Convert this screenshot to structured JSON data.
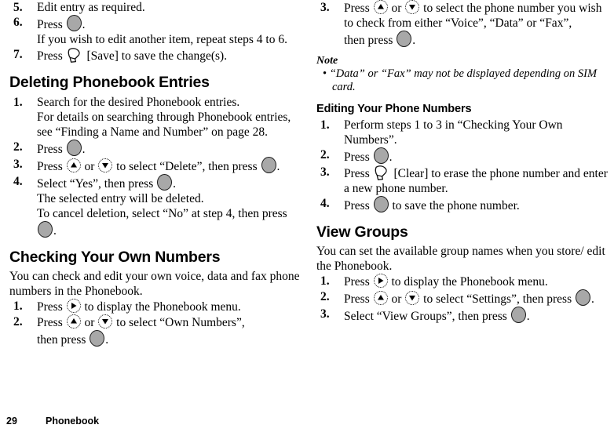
{
  "page": {
    "number": "29",
    "chapter": "Phonebook"
  },
  "left_column": {
    "continued_steps": [
      {
        "num": "5.",
        "text": "Edit entry as required."
      },
      {
        "num": "6.",
        "text_before": "Press",
        "icon": "select-key-icon",
        "text_after": "."
      },
      {
        "sub": "If you wish to edit another item, repeat steps 4 to 6."
      },
      {
        "num": "7.",
        "text_before": "Press",
        "icon": "softkey-icon",
        "text_after": "[Save] to save the change(s)."
      }
    ],
    "section1": {
      "heading": "Deleting Phonebook Entries",
      "steps": [
        {
          "num": "1.",
          "text": "Search for the desired Phonebook entries."
        },
        {
          "sub": "For details on searching through Phonebook entries, see “Finding a Name and Number” on page 28."
        },
        {
          "num": "2.",
          "text_before": "Press",
          "icon": "select-key-icon",
          "text_after": "."
        },
        {
          "num": "3.",
          "text_before": "Press",
          "icon_up": "nav-up-icon",
          "mid": "or",
          "icon_down": "nav-down-icon",
          "text_mid": "to select “Delete”, then press",
          "icon": "select-key-icon",
          "text_after": "."
        },
        {
          "num": "4.",
          "text_before": "Select “Yes”, then press",
          "icon": "select-key-icon",
          "text_after": "."
        },
        {
          "sub": "The selected entry will be deleted."
        },
        {
          "sub2_before": "To cancel deletion, select “No” at step 4, then press",
          "icon": "select-key-icon",
          "sub2_after": "."
        }
      ]
    },
    "section2": {
      "heading": "Checking Your Own Numbers",
      "intro": "You can check and edit your own voice, data and fax phone numbers in the Phonebook.",
      "steps": [
        {
          "num": "1.",
          "text_before": "Press",
          "icon": "nav-right-icon",
          "text_after": "to display the Phonebook menu."
        },
        {
          "num": "2.",
          "text_before": "Press",
          "icon_up": "nav-up-icon",
          "mid": "or",
          "icon_down": "nav-down-icon",
          "text_mid": "to select “Own Numbers”,",
          "line2_before": "then press",
          "icon": "select-key-icon",
          "line2_after": "."
        }
      ]
    }
  },
  "right_column": {
    "continued_step": {
      "num": "3.",
      "text_before": "Press",
      "icon_up": "nav-up-icon",
      "mid": "or",
      "icon_down": "nav-down-icon",
      "text_mid": "to select the phone number you wish to check from either “Voice”, “Data” or “Fax”,",
      "line3_before": "then press",
      "icon": "select-key-icon",
      "line3_after": "."
    },
    "note": {
      "title": "Note",
      "bullet": "•",
      "text": "“Data” or “Fax” may not be displayed depending on SIM card."
    },
    "section1": {
      "heading": "Editing Your Phone Numbers",
      "steps": [
        {
          "num": "1.",
          "text": "Perform steps 1 to 3 in “Checking Your Own Numbers”."
        },
        {
          "num": "2.",
          "text_before": "Press",
          "icon": "select-key-icon",
          "text_after": "."
        },
        {
          "num": "3.",
          "text_before": "Press",
          "icon": "softkey-icon",
          "text_after": "[Clear] to erase the phone number and enter a new phone number."
        },
        {
          "num": "4.",
          "text_before": "Press",
          "icon": "select-key-icon",
          "text_after": "to save the phone number."
        }
      ]
    },
    "section2": {
      "heading": "View Groups",
      "intro": "You can set the available group names when you store/ edit the Phonebook.",
      "steps": [
        {
          "num": "1.",
          "text_before": "Press",
          "icon": "nav-right-icon",
          "text_after": "to display the Phonebook menu."
        },
        {
          "num": "2.",
          "text_before": "Press",
          "icon_up": "nav-up-icon",
          "mid": "or",
          "icon_down": "nav-down-icon",
          "text_mid": "to select “Settings”, then press",
          "icon": "select-key-icon",
          "text_after": "."
        },
        {
          "num": "3.",
          "text_before": "Select “View Groups”, then press",
          "icon": "select-key-icon",
          "text_after": "."
        }
      ]
    }
  }
}
